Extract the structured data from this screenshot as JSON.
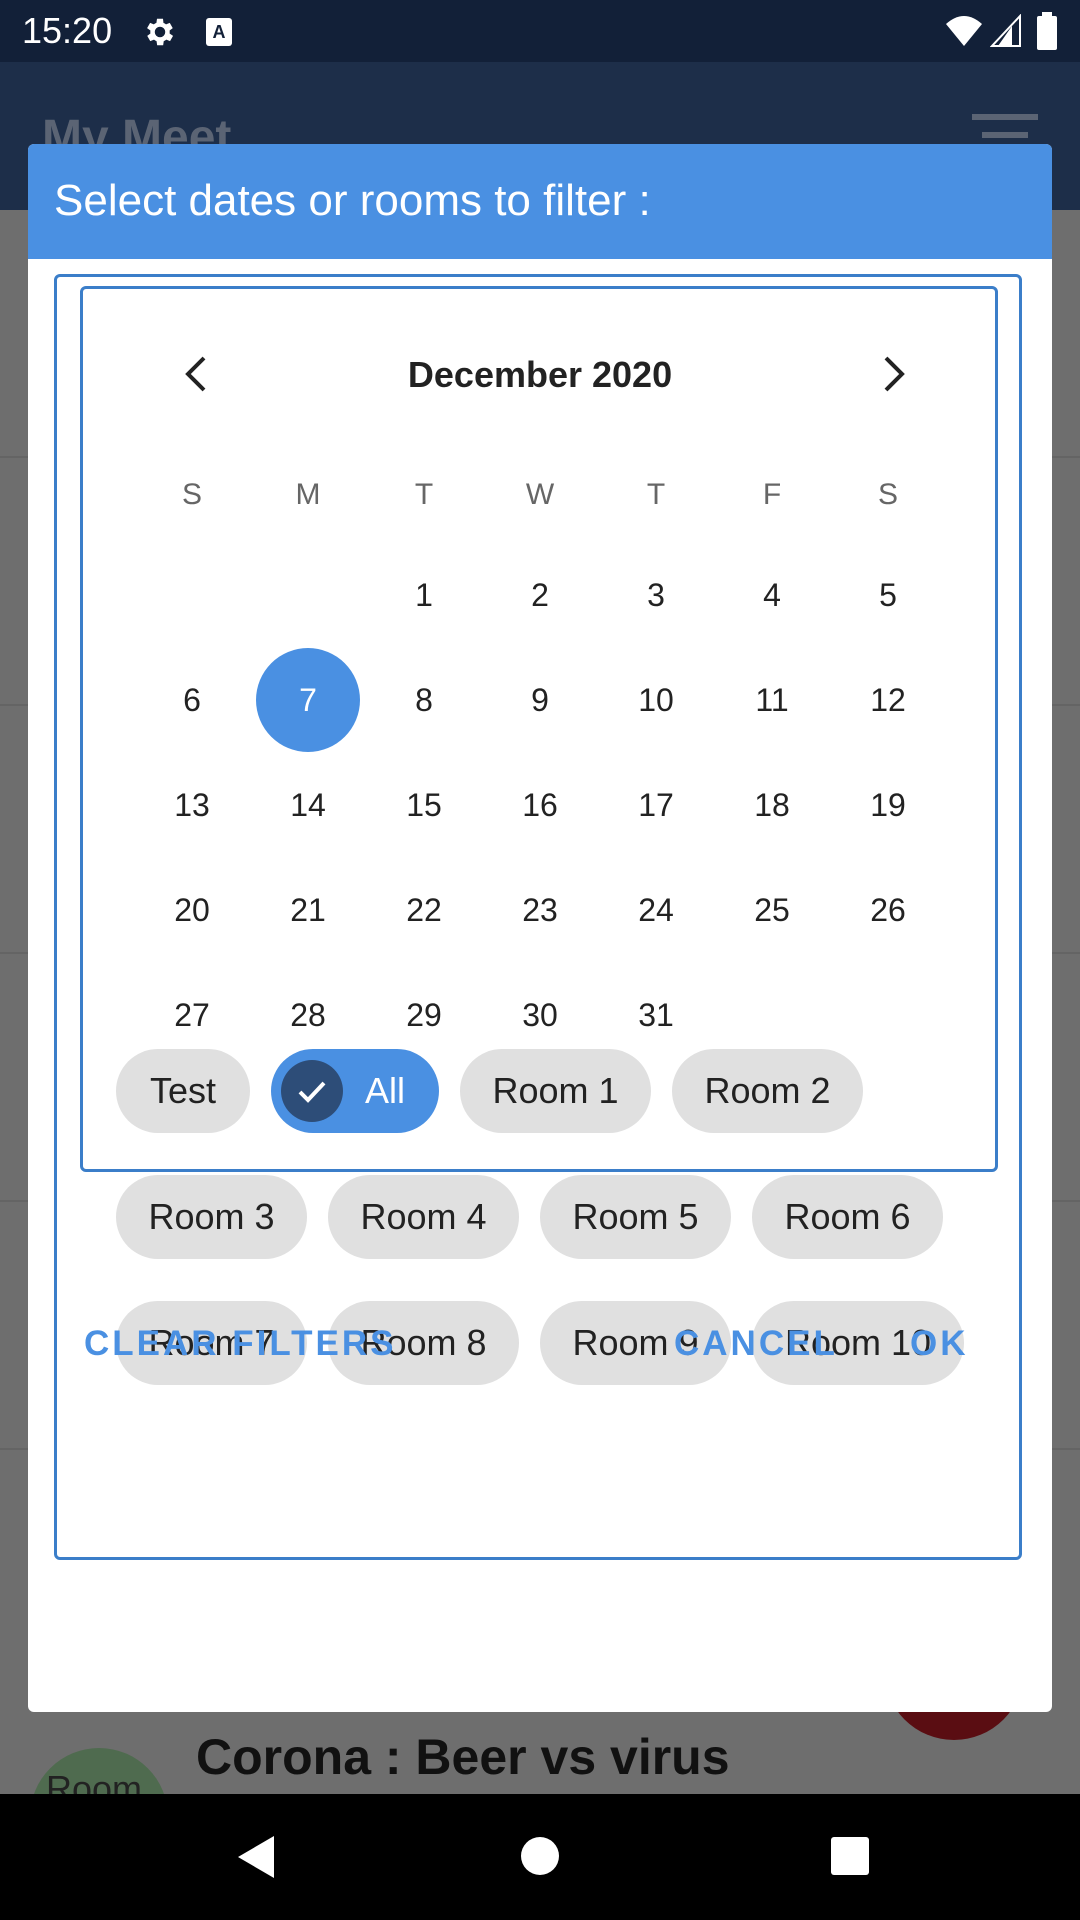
{
  "status_bar": {
    "time": "15:20"
  },
  "app": {
    "title": "My Meet",
    "row_title": "Corona : Beer vs virus",
    "row_avatar_text": "Room"
  },
  "dialog": {
    "title": "Select dates or rooms to filter :",
    "calendar": {
      "month_label": "December 2020",
      "weekdays": [
        "S",
        "M",
        "T",
        "W",
        "T",
        "F",
        "S"
      ],
      "weeks": [
        [
          "",
          "",
          "1",
          "2",
          "3",
          "4",
          "5"
        ],
        [
          "6",
          "7",
          "8",
          "9",
          "10",
          "11",
          "12"
        ],
        [
          "13",
          "14",
          "15",
          "16",
          "17",
          "18",
          "19"
        ],
        [
          "20",
          "21",
          "22",
          "23",
          "24",
          "25",
          "26"
        ],
        [
          "27",
          "28",
          "29",
          "30",
          "31",
          "",
          ""
        ]
      ],
      "selected_day": "7"
    },
    "chips": [
      {
        "label": "Test",
        "selected": false
      },
      {
        "label": "All",
        "selected": true
      },
      {
        "label": "Room 1",
        "selected": false
      },
      {
        "label": "Room 2",
        "selected": false
      },
      {
        "label": "Room 3",
        "selected": false
      },
      {
        "label": "Room 4",
        "selected": false
      },
      {
        "label": "Room 5",
        "selected": false
      },
      {
        "label": "Room 6",
        "selected": false
      },
      {
        "label": "Room 7",
        "selected": false
      },
      {
        "label": "Room 8",
        "selected": false
      },
      {
        "label": "Room 9",
        "selected": false
      },
      {
        "label": "Room 10",
        "selected": false
      }
    ],
    "actions": {
      "clear": "CLEAR FILTERS",
      "cancel": "CANCEL",
      "ok": "OK"
    }
  },
  "colors": {
    "accent": "#4a90e2",
    "chip_bg": "#e0e0e0",
    "check_bg": "#2d4d78"
  }
}
